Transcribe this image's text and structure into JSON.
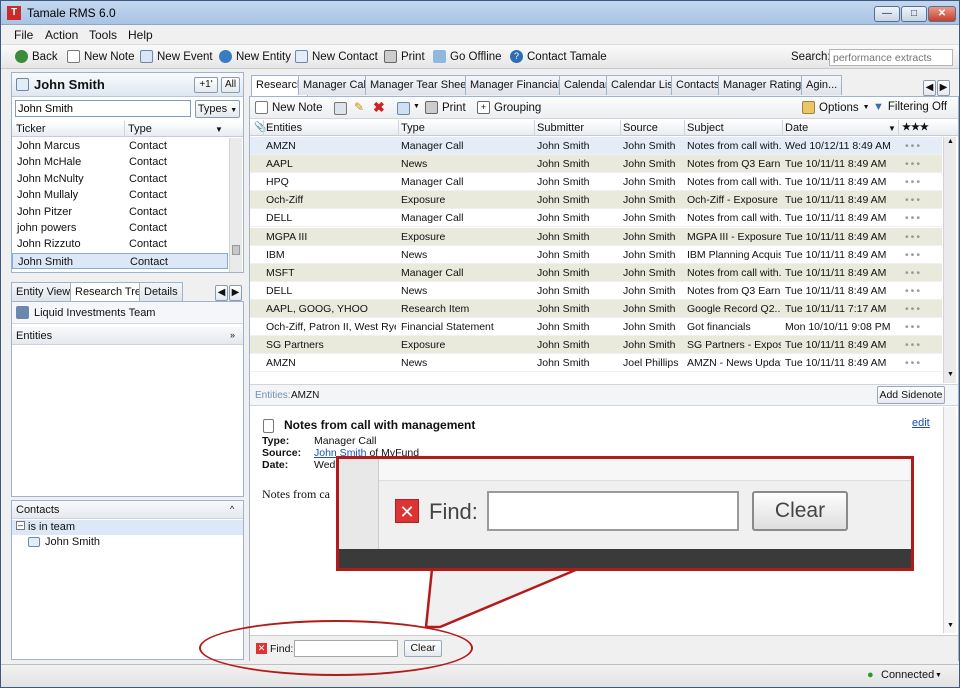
{
  "window": {
    "title": "Tamale RMS 6.0",
    "app_icon_glyph": "T"
  },
  "menu": [
    "File",
    "Action",
    "Tools",
    "Help"
  ],
  "toolbar": {
    "back": "Back",
    "new_note": "New Note",
    "new_event": "New Event",
    "new_entity": "New Entity",
    "new_contact": "New Contact",
    "print": "Print",
    "go_offline": "Go Offline",
    "contact": "Contact Tamale",
    "search_label": "Search:",
    "search_placeholder": "performance extracts"
  },
  "left_panel": {
    "name": "John Smith",
    "plus_btn": "+1'",
    "all_btn": "All",
    "filter_value": "John Smith",
    "types_btn": "Types",
    "columns": [
      "Ticker",
      "Type"
    ],
    "rows": [
      {
        "name": "John Marcus",
        "type": "Contact"
      },
      {
        "name": "John McHale",
        "type": "Contact"
      },
      {
        "name": "John McNulty",
        "type": "Contact"
      },
      {
        "name": "John Mullaly",
        "type": "Contact"
      },
      {
        "name": "John Pitzer",
        "type": "Contact"
      },
      {
        "name": "john powers",
        "type": "Contact"
      },
      {
        "name": "John Rizzuto",
        "type": "Contact"
      },
      {
        "name": "John Smith",
        "type": "Contact"
      }
    ]
  },
  "left_tabs": [
    "Entity View",
    "Research Tree",
    "Details"
  ],
  "research_tree": {
    "team": "Liquid Investments Team",
    "entities_header": "Entities"
  },
  "contacts": {
    "header": "Contacts",
    "group": "is in team",
    "member": "John Smith"
  },
  "main_tabs": [
    "Research",
    "Manager Call",
    "Manager Tear Sheet",
    "Manager Financials",
    "Calendar",
    "Calendar List",
    "Contacts",
    "Manager Ratings",
    "Agin..."
  ],
  "main_toolbar": {
    "new_note": "New Note",
    "print": "Print",
    "grouping": "Grouping",
    "options": "Options",
    "filtering": "Filtering Off"
  },
  "grid": {
    "columns": [
      "Entities",
      "Type",
      "Submitter",
      "Source",
      "Subject",
      "Date",
      "★★★"
    ],
    "rows": [
      {
        "entities": "AMZN",
        "type": "Manager Call",
        "submitter": "John Smith",
        "source": "John Smith",
        "subject": "Notes from call with...",
        "date": "Wed 10/12/11 8:49 AM"
      },
      {
        "entities": "AAPL",
        "type": "News",
        "submitter": "John Smith",
        "source": "John Smith",
        "subject": "Notes from Q3 Earni...",
        "date": "Tue 10/11/11 8:49 AM"
      },
      {
        "entities": "HPQ",
        "type": "Manager Call",
        "submitter": "John Smith",
        "source": "John Smith",
        "subject": "Notes from call with...",
        "date": "Tue 10/11/11 8:49 AM"
      },
      {
        "entities": "Och-Ziff",
        "type": "Exposure",
        "submitter": "John Smith",
        "source": "John Smith",
        "subject": "Och-Ziff - Exposure",
        "date": "Tue 10/11/11 8:49 AM"
      },
      {
        "entities": "DELL",
        "type": "Manager Call",
        "submitter": "John Smith",
        "source": "John Smith",
        "subject": "Notes from call with...",
        "date": "Tue 10/11/11 8:49 AM"
      },
      {
        "entities": "MGPA III",
        "type": "Exposure",
        "submitter": "John Smith",
        "source": "John Smith",
        "subject": "MGPA III - Exposure",
        "date": "Tue 10/11/11 8:49 AM"
      },
      {
        "entities": "IBM",
        "type": "News",
        "submitter": "John Smith",
        "source": "John Smith",
        "subject": "IBM Planning Acquis...",
        "date": "Tue 10/11/11 8:49 AM"
      },
      {
        "entities": "MSFT",
        "type": "Manager Call",
        "submitter": "John Smith",
        "source": "John Smith",
        "subject": "Notes from call with...",
        "date": "Tue 10/11/11 8:49 AM"
      },
      {
        "entities": "DELL",
        "type": "News",
        "submitter": "John Smith",
        "source": "John Smith",
        "subject": "Notes from Q3 Earni...",
        "date": "Tue 10/11/11 8:49 AM"
      },
      {
        "entities": "AAPL, GOOG, YHOO",
        "type": "Research Item",
        "submitter": "John Smith",
        "source": "John Smith",
        "subject": "Google Record Q2...",
        "date": "Tue 10/11/11 7:17 AM"
      },
      {
        "entities": "Och-Ziff, Patron II, West Rye...",
        "type": "Financial Statement",
        "submitter": "John Smith",
        "source": "John Smith",
        "subject": "Got financials",
        "date": "Mon 10/10/11 9:08 PM"
      },
      {
        "entities": "SG Partners",
        "type": "Exposure",
        "submitter": "John Smith",
        "source": "John Smith",
        "subject": "SG Partners - Expos...",
        "date": "Tue 10/11/11 8:49 AM"
      },
      {
        "entities": "AMZN",
        "type": "News",
        "submitter": "John Smith",
        "source": "Joel Phillips",
        "subject": "AMZN - News Updat...",
        "date": "Tue 10/11/11 8:49 AM"
      }
    ]
  },
  "detail": {
    "entities_label": "Entities:",
    "entities_value": "AMZN",
    "add_sidenote": "Add Sidenote",
    "title": "Notes from call with management",
    "edit": "edit",
    "type_label": "Type:",
    "type_value": "Manager Call",
    "source_label": "Source:",
    "source_link": "John Smith",
    "source_suffix": "of MyFund",
    "date_label": "Date:",
    "date_value": "Wed",
    "body": "Notes from ca"
  },
  "find": {
    "label": "Find:",
    "clear": "Clear"
  },
  "status": {
    "connection": "Connected"
  },
  "colors": {
    "accent": "#b31b1b",
    "selection": "#dde8f7",
    "alt_row": "#e9e9dc"
  }
}
